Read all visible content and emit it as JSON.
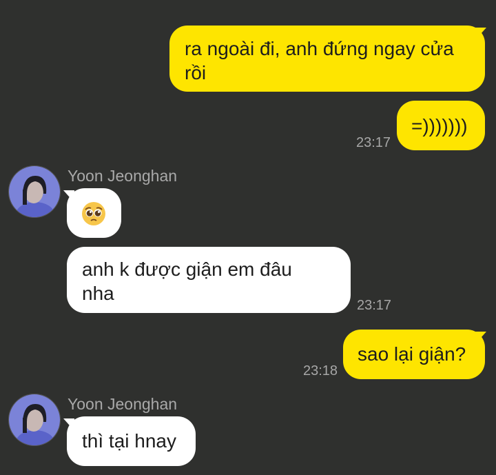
{
  "messages": [
    {
      "from": "me",
      "text": "ra ngoài đi, anh đứng ngay cửa rồi"
    },
    {
      "from": "me",
      "text": "=)))))))",
      "time": "23:17"
    },
    {
      "from": "them",
      "sender": "Yoon Jeonghan",
      "emoji": "pleading-face",
      "text": ""
    },
    {
      "from": "them",
      "text": "anh k được giận em đâu nha",
      "time": "23:17"
    },
    {
      "from": "me",
      "text": "sao lại giận?",
      "time": "23:18"
    },
    {
      "from": "them",
      "sender": "Yoon Jeonghan",
      "text": "thì tại hnay"
    }
  ],
  "colors": {
    "background": "#2f302e",
    "outgoing_bubble": "#fee500",
    "incoming_bubble": "#ffffff",
    "timestamp": "#a7a7a7",
    "sender_name": "#a9a9a9"
  }
}
